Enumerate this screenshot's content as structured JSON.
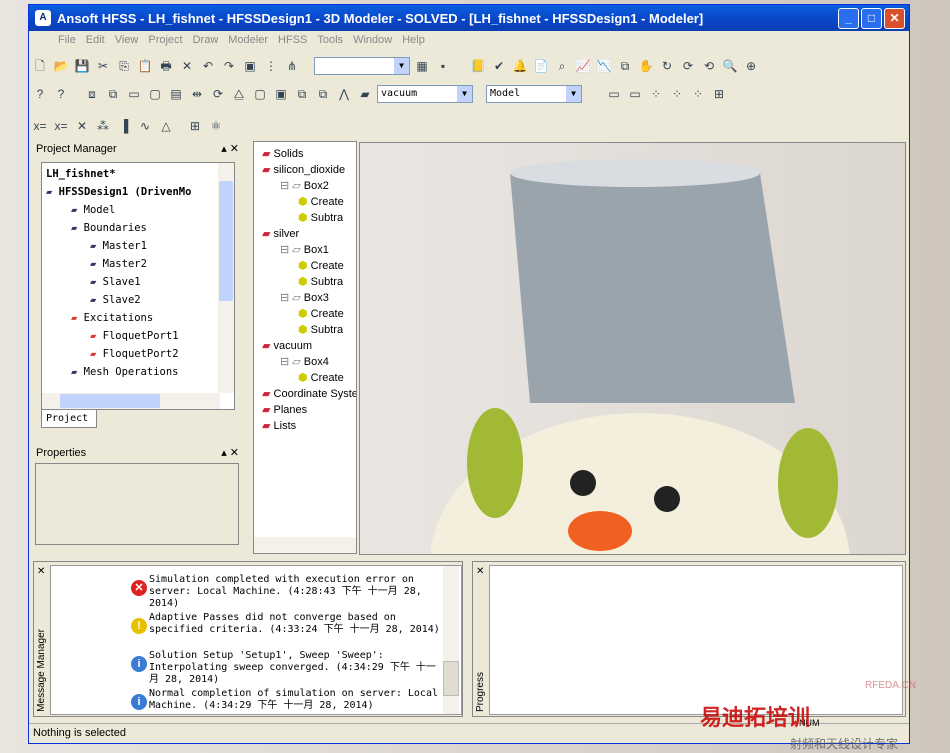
{
  "window": {
    "title": "Ansoft HFSS - LH_fishnet - HFSSDesign1 - 3D Modeler - SOLVED - [LH_fishnet - HFSSDesign1 - Modeler]"
  },
  "menu": [
    "File",
    "Edit",
    "View",
    "Project",
    "Draw",
    "Modeler",
    "HFSS",
    "Tools",
    "Window",
    "Help"
  ],
  "toolbar": {
    "material_select": "vacuum",
    "model_select": "Model",
    "empty_select": ""
  },
  "project_manager": {
    "title": "Project Manager",
    "tab": "Project",
    "items": [
      {
        "label": "LH_fishnet*",
        "level": 0
      },
      {
        "label": "HFSSDesign1 (DrivenMo",
        "level": 0
      },
      {
        "label": "Model",
        "level": 1
      },
      {
        "label": "Boundaries",
        "level": 1
      },
      {
        "label": "Master1",
        "level": 2
      },
      {
        "label": "Master2",
        "level": 2
      },
      {
        "label": "Slave1",
        "level": 2
      },
      {
        "label": "Slave2",
        "level": 2
      },
      {
        "label": "Excitations",
        "level": 1
      },
      {
        "label": "FloquetPort1",
        "level": 2
      },
      {
        "label": "FloquetPort2",
        "level": 2
      },
      {
        "label": "Mesh Operations",
        "level": 1
      }
    ]
  },
  "properties": {
    "title": "Properties"
  },
  "model_tree": [
    {
      "label": "Solids",
      "level": 0
    },
    {
      "label": "silicon_dioxide",
      "level": 0
    },
    {
      "label": "Box2",
      "level": 1
    },
    {
      "label": "Create",
      "level": 2
    },
    {
      "label": "Subtra",
      "level": 2
    },
    {
      "label": "silver",
      "level": 0
    },
    {
      "label": "Box1",
      "level": 1
    },
    {
      "label": "Create",
      "level": 2
    },
    {
      "label": "Subtra",
      "level": 2
    },
    {
      "label": "Box3",
      "level": 1
    },
    {
      "label": "Create",
      "level": 2
    },
    {
      "label": "Subtra",
      "level": 2
    },
    {
      "label": "vacuum",
      "level": 0
    },
    {
      "label": "Box4",
      "level": 1
    },
    {
      "label": "Create",
      "level": 2
    },
    {
      "label": "Coordinate System",
      "level": 0
    },
    {
      "label": "Planes",
      "level": 0
    },
    {
      "label": "Lists",
      "level": 0
    }
  ],
  "messages": {
    "title": "Message Manager",
    "items": [
      {
        "type": "error",
        "text": "Simulation completed with execution error on server: Local Machine. (4:28:43 下午  十一月 28, 2014)"
      },
      {
        "type": "warning",
        "text": "Adaptive Passes did not converge based on specified criteria. (4:33:24 下午  十一月 28, 2014)"
      },
      {
        "type": "info",
        "text": "Solution Setup 'Setup1', Sweep 'Sweep': Interpolating sweep converged. (4:34:29 下午  十一月 28, 2014)"
      },
      {
        "type": "info",
        "text": "Normal completion of simulation on server: Local Machine. (4:34:29 下午  十一月 28, 2014)"
      }
    ]
  },
  "progress": {
    "title": "Progress"
  },
  "status": {
    "text": "Nothing is selected",
    "num": "NUM"
  },
  "watermark": {
    "site": "RFEDA.CN",
    "brand": "易迪拓培训",
    "sub": "射频和天线设计专家"
  }
}
